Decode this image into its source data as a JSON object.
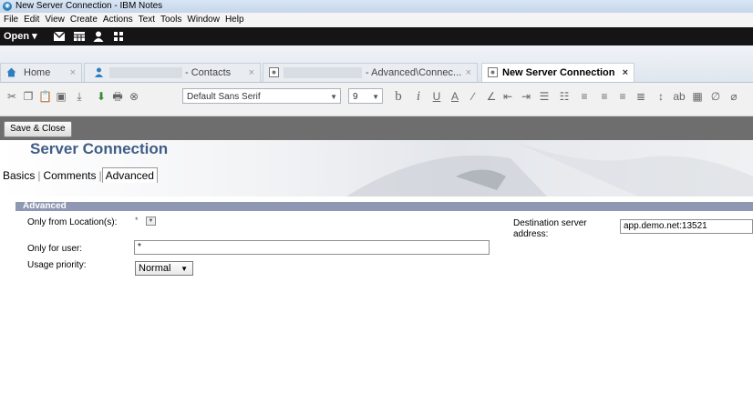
{
  "window": {
    "title": "New Server Connection - IBM Notes"
  },
  "menu": [
    "File",
    "Edit",
    "View",
    "Create",
    "Actions",
    "Text",
    "Tools",
    "Window",
    "Help"
  ],
  "topbar": {
    "open_label": "Open ▾"
  },
  "tabs": [
    {
      "label": "Home",
      "close": "×"
    },
    {
      "label": "- Contacts",
      "close": "×"
    },
    {
      "label": "- Advanced\\Connec...",
      "close": "×"
    },
    {
      "label": "New Server Connection",
      "close": "×"
    }
  ],
  "format_toolbar": {
    "font": "Default Sans Serif",
    "size": "9"
  },
  "actions": {
    "save_close": "Save & Close"
  },
  "form": {
    "title": "Server Connection",
    "tabs": [
      "Basics",
      "Comments",
      "Advanced"
    ],
    "section_title": "Advanced",
    "only_from_location_label": "Only from Location(s):",
    "only_from_location_value": "*",
    "only_for_user_label": "Only for user:",
    "only_for_user_value": "*",
    "usage_priority_label": "Usage priority:",
    "usage_priority_value": "Normal",
    "destination_label_line1": "Destination server",
    "destination_label_line2": "address:",
    "destination_value": "app.demo.net:13521"
  }
}
